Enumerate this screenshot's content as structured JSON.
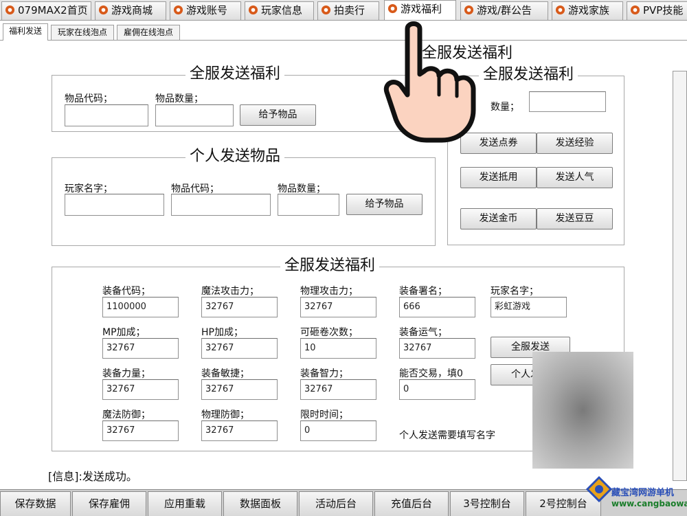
{
  "top_tabs": [
    "079MAX2首页",
    "游戏商城",
    "游戏账号",
    "玩家信息",
    "拍卖行",
    "游戏福利",
    "游戏/群公告",
    "游戏家族",
    "PVP技能"
  ],
  "sub_tabs": [
    "福利发送",
    "玩家在线泡点",
    "雇佣在线泡点"
  ],
  "pane": {
    "overlay_title": "全服发送福利",
    "group1": {
      "title": "全服发送福利",
      "item_code_label": "物品代码；",
      "item_qty_label": "物品数量；",
      "item_code_value": "",
      "item_qty_value": "",
      "give_button": "给予物品"
    },
    "group2": {
      "title": "个人发送物品",
      "player_name_label": "玩家名字；",
      "item_code_label": "物品代码；",
      "item_qty_label": "物品数量；",
      "player_name_value": "",
      "item_code_value": "",
      "item_qty_value": "",
      "give_button": "给予物品"
    },
    "group3": {
      "title": "全服发送福利",
      "qty_label": "数量；",
      "qty_value": "",
      "buttons": [
        "发送点券",
        "发送经验",
        "发送抵用",
        "发送人气",
        "发送金币",
        "发送豆豆"
      ]
    },
    "group4": {
      "title": "全服发送福利",
      "fields": [
        {
          "label": "装备代码；",
          "value": "1100000"
        },
        {
          "label": "魔法攻击力；",
          "value": "32767"
        },
        {
          "label": "物理攻击力；",
          "value": "32767"
        },
        {
          "label": "装备署名；",
          "value": "666"
        },
        {
          "label": "玩家名字；",
          "value": "彩虹游戏"
        },
        {
          "label": "MP加成；",
          "value": "32767"
        },
        {
          "label": "HP加成；",
          "value": "32767"
        },
        {
          "label": "可砸卷次数；",
          "value": "10"
        },
        {
          "label": "装备运气；",
          "value": "32767"
        },
        {
          "label": "装备力量；",
          "value": "32767"
        },
        {
          "label": "装备敏捷；",
          "value": "32767"
        },
        {
          "label": "装备智力；",
          "value": "32767"
        },
        {
          "label": "能否交易，填0",
          "value": "0"
        },
        {
          "label": "魔法防御；",
          "value": "32767"
        },
        {
          "label": "物理防御；",
          "value": "32767"
        },
        {
          "label": "限时时间；",
          "value": "0"
        }
      ],
      "send_all_button": "全服发送",
      "send_personal_button": "个人发送",
      "note": "个人发送需要填写名字"
    },
    "status_message": "[信息]:发送成功。"
  },
  "bottom_buttons": [
    "保存数据",
    "保存雇佣",
    "应用重载",
    "数据面板",
    "活动后台",
    "充值后台",
    "3号控制台",
    "2号控制台"
  ],
  "watermark": {
    "text": "藏宝湾网游单机",
    "url": "www.cangbaowan.net"
  },
  "colors": {
    "tab_icon": "#c0392b",
    "accent_blue": "#2a4fb8"
  }
}
